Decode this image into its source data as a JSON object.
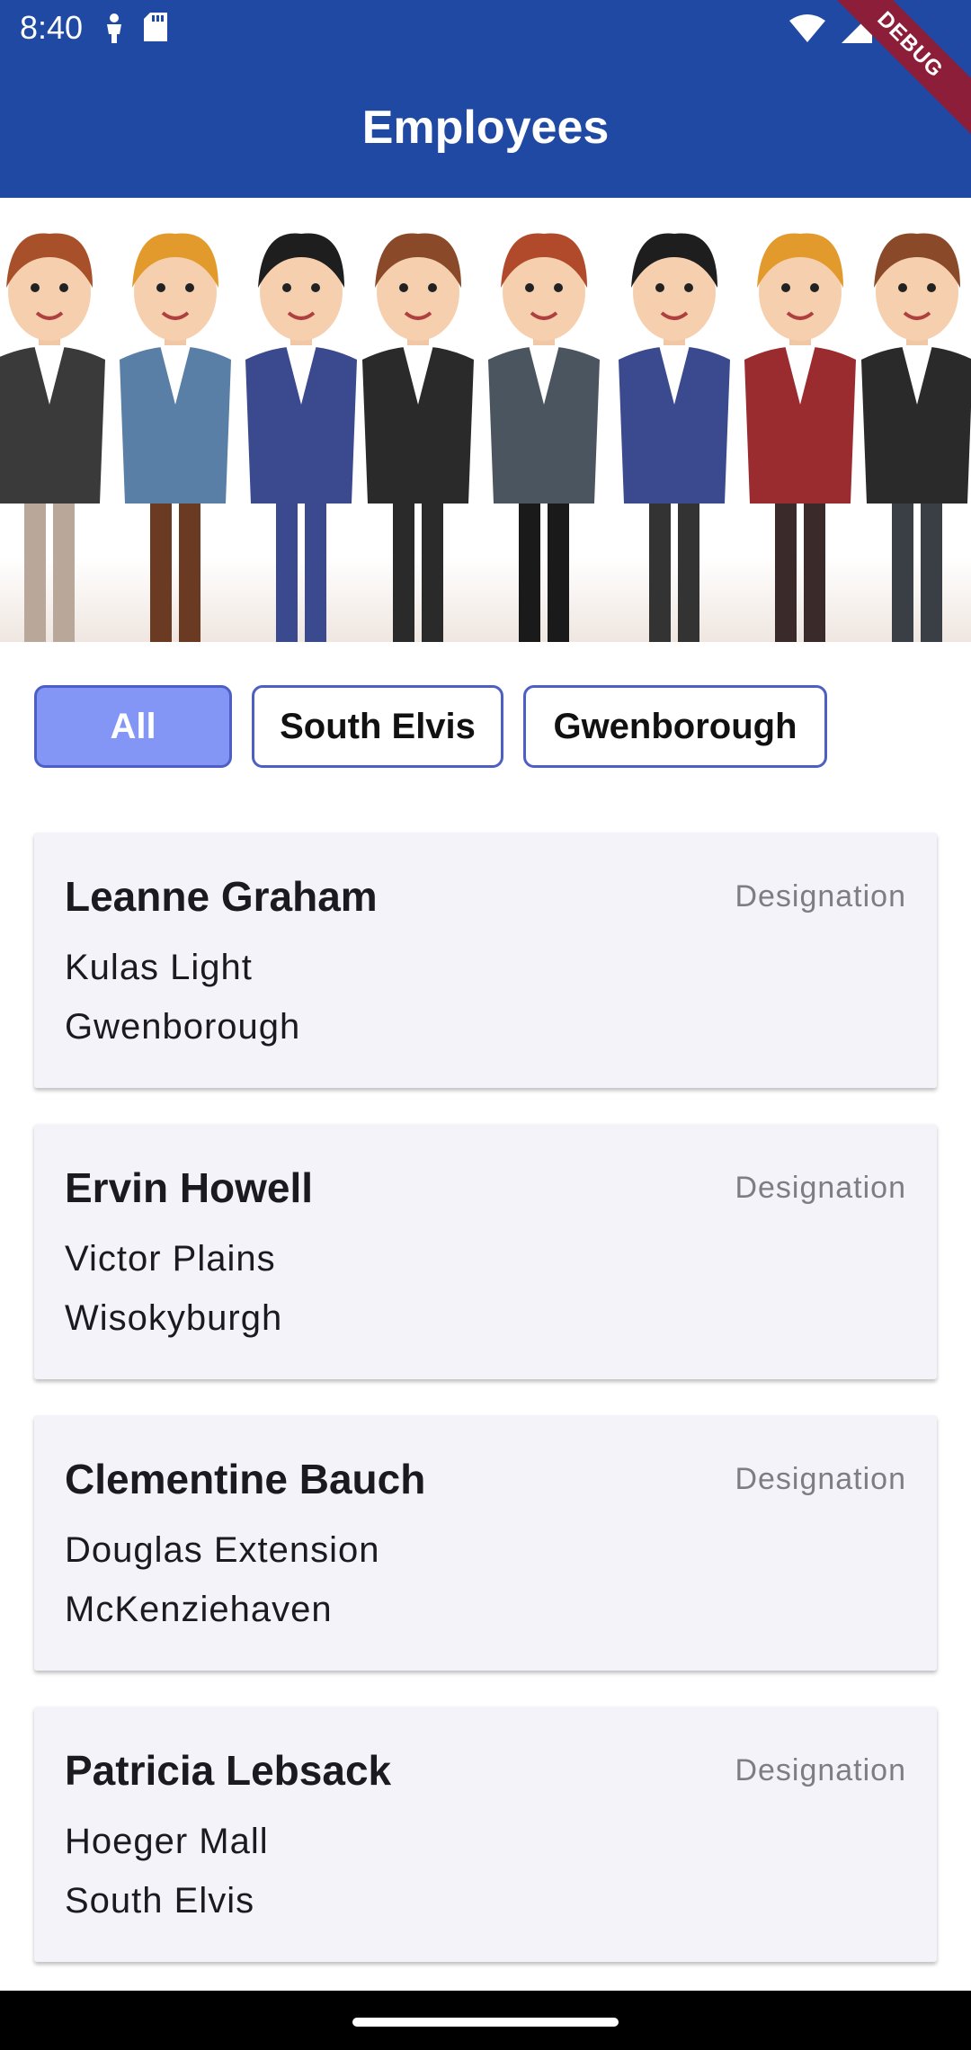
{
  "status_bar": {
    "time": "8:40",
    "left_icons": [
      "person-icon",
      "sd-card-icon"
    ],
    "right_icons": [
      "wifi-icon",
      "signal-icon",
      "battery-icon"
    ]
  },
  "app_bar": {
    "title": "Employees",
    "background": "#1f49a3"
  },
  "debug_banner": "DEBUG",
  "hero_image": "employees-group-illustration",
  "filters": {
    "chips": [
      {
        "label": "All",
        "selected": true
      },
      {
        "label": "South Elvis",
        "selected": false
      },
      {
        "label": "Gwenborough",
        "selected": false
      }
    ],
    "accent": "#8396f5"
  },
  "employees": [
    {
      "name": "Leanne Graham",
      "designation": "Designation",
      "street": "Kulas Light",
      "city": "Gwenborough"
    },
    {
      "name": "Ervin Howell",
      "designation": "Designation",
      "street": "Victor Plains",
      "city": "Wisokyburgh"
    },
    {
      "name": "Clementine Bauch",
      "designation": "Designation",
      "street": "Douglas Extension",
      "city": "McKenziehaven"
    },
    {
      "name": "Patricia Lebsack",
      "designation": "Designation",
      "street": "Hoeger Mall",
      "city": "South Elvis"
    }
  ]
}
